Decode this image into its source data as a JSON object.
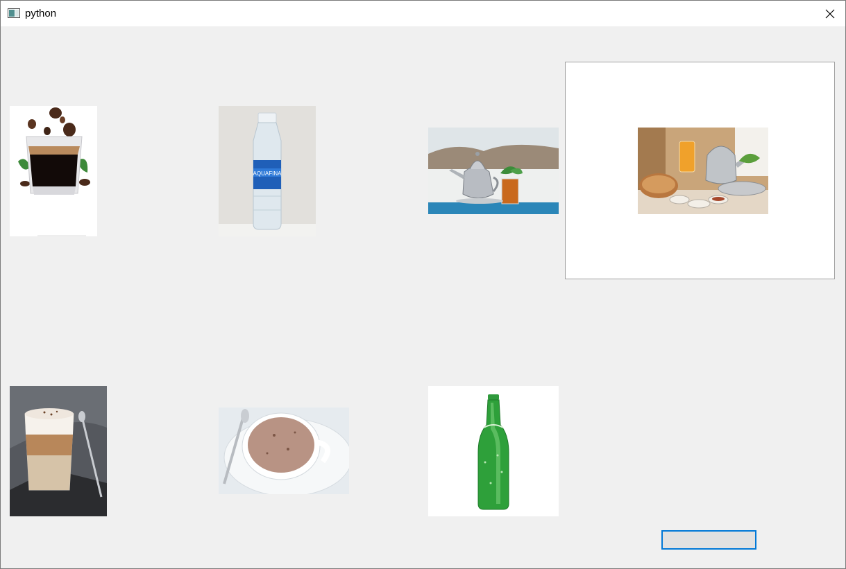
{
  "window": {
    "title": "python",
    "close_label": "×"
  },
  "drinks": [
    {
      "name": "espresso-coffee"
    },
    {
      "name": "water-bottle",
      "label_text": "AQUAFINA"
    },
    {
      "name": "moroccan-mint-tea"
    },
    {
      "name": "moroccan-breakfast",
      "selected": true
    },
    {
      "name": "latte-macchiato"
    },
    {
      "name": "hot-chocolate"
    },
    {
      "name": "green-soda-bottle"
    }
  ],
  "action_button": {
    "label": ""
  },
  "colors": {
    "background": "#f0f0f0",
    "titlebar": "#ffffff",
    "focus_border": "#0078d7",
    "button_face": "#e1e1e1"
  }
}
